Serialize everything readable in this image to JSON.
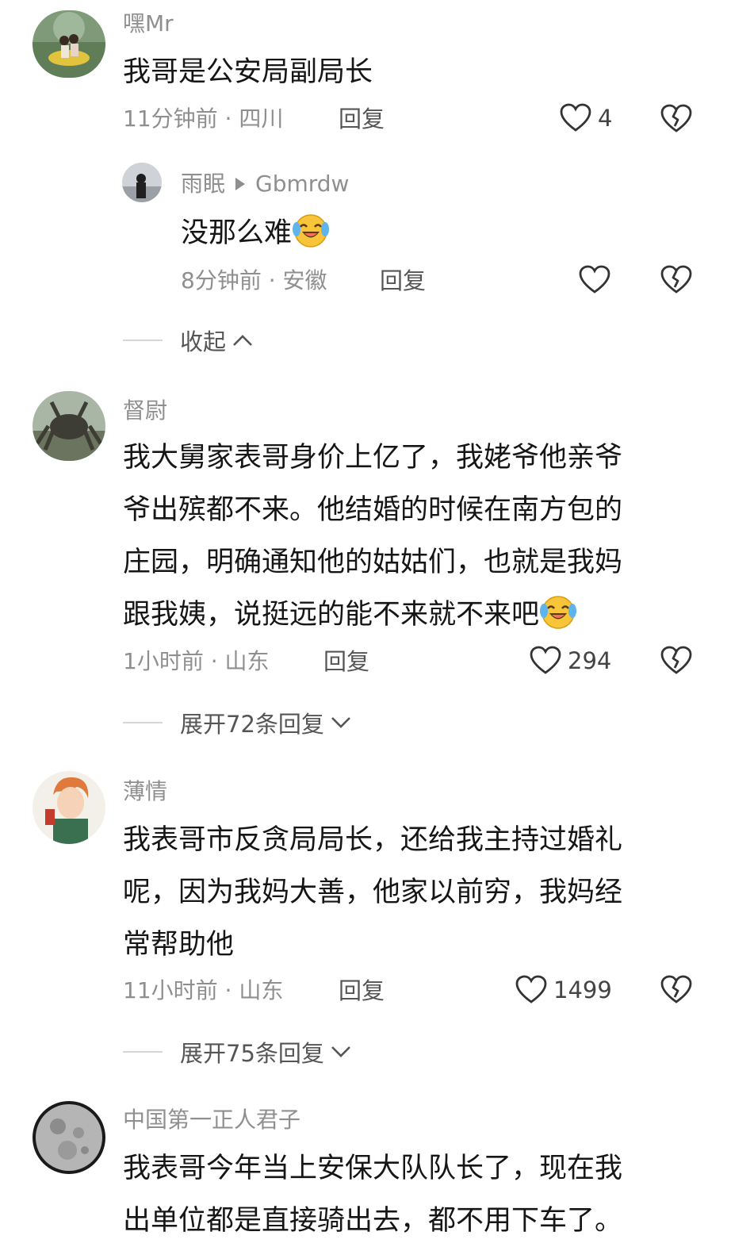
{
  "comments": [
    {
      "username": "嘿Mr",
      "text": "我哥是公安局副局长",
      "meta": "11分钟前 · 四川",
      "reply_label": "回复",
      "likes": "4",
      "reply": {
        "username": "雨眠",
        "reply_to": "Gbmrdw",
        "text": "没那么难",
        "emoji": "laughing-crying-emoji",
        "meta": "8分钟前 · 安徽",
        "reply_label": "回复"
      },
      "toggle_label": "收起"
    },
    {
      "username": "督尉",
      "text_lines": [
        "我大舅家表哥身价上亿了，我姥爷他亲爷",
        "爷出殡都不来。他结婚的时候在南方包的",
        "庄园，明确通知他的姑姑们，也就是我妈",
        "跟我姨，说挺远的能不来就不来吧"
      ],
      "emoji": "laughing-crying-emoji",
      "meta": "1小时前 · 山东",
      "reply_label": "回复",
      "likes": "294",
      "toggle_label": "展开72条回复"
    },
    {
      "username": "薄情",
      "text_lines": [
        "我表哥市反贪局局长，还给我主持过婚礼",
        "呢，因为我妈大善，他家以前穷，我妈经",
        "常帮助他"
      ],
      "meta": "11小时前 · 山东",
      "reply_label": "回复",
      "likes": "1499",
      "toggle_label": "展开75条回复"
    },
    {
      "username": "中国第一正人君子",
      "text_lines": [
        "我表哥今年当上安保大队队长了，现在我",
        "出单位都是直接骑出去，都不用下车了。"
      ]
    }
  ],
  "colors": {
    "primary_text": "#161616",
    "secondary_text": "#8f8f8f",
    "divider": "#d6d6d6"
  },
  "icons": [
    "heart-icon",
    "broken-heart-icon",
    "chevron-up-icon",
    "chevron-down-icon",
    "play-arrow-icon"
  ]
}
